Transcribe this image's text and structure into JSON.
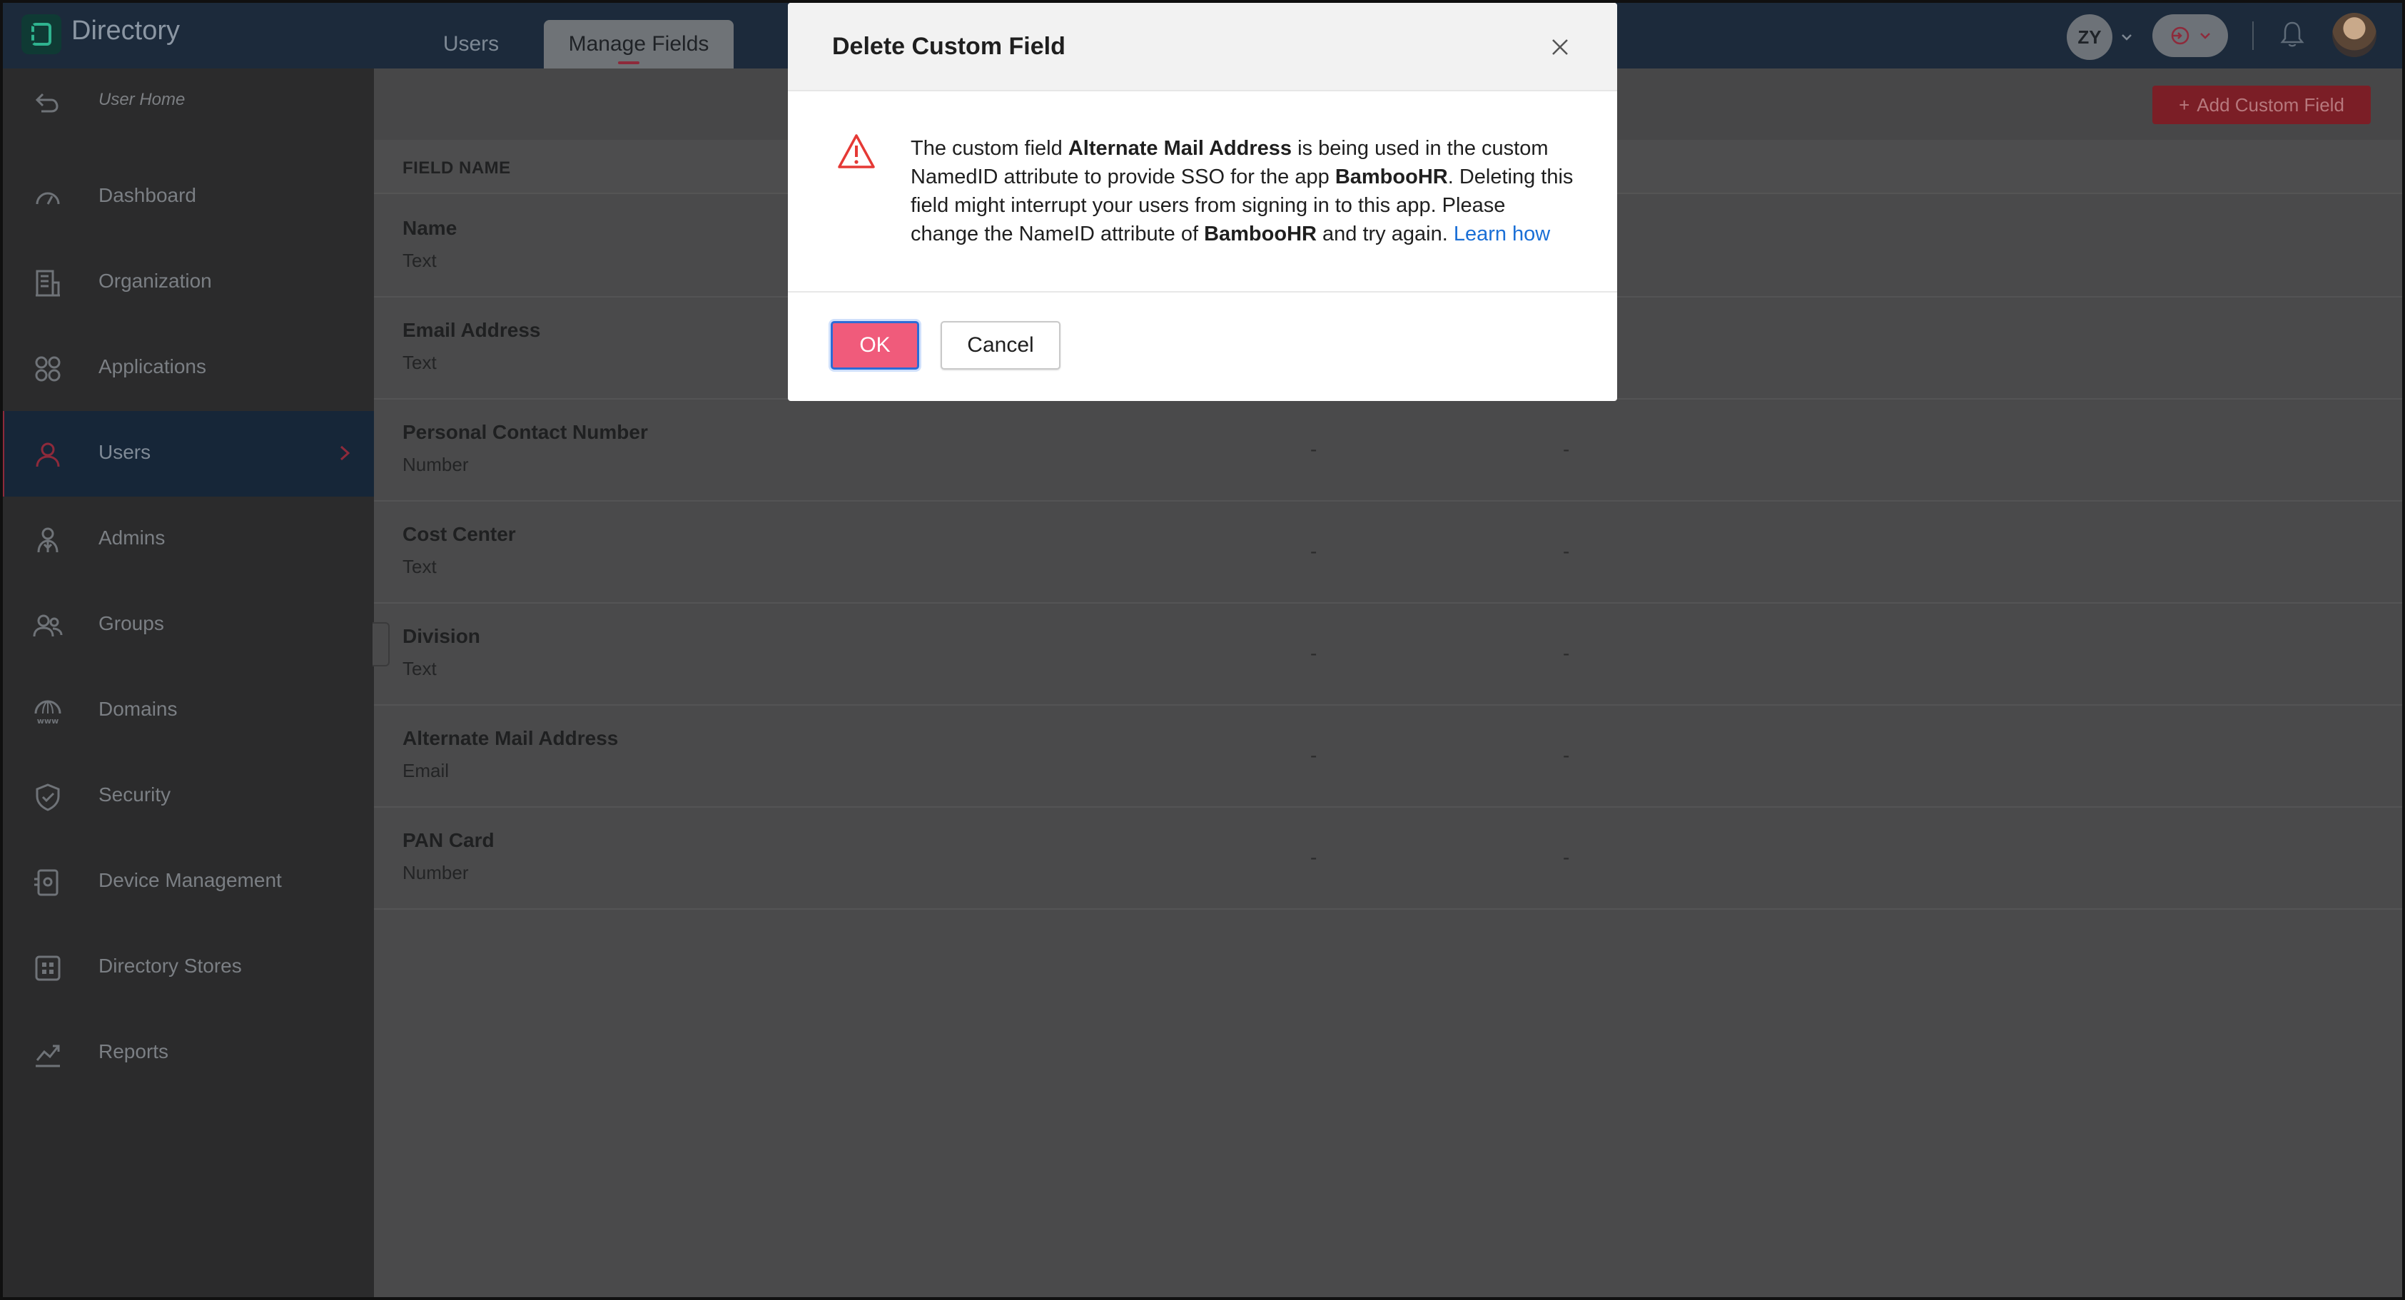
{
  "app": {
    "title": "Directory"
  },
  "top_tabs": [
    {
      "label": "Users"
    },
    {
      "label": "Manage Fields"
    }
  ],
  "header": {
    "avatar_initials": "ZY"
  },
  "sidebar": {
    "back_label": "User Home",
    "items": [
      {
        "label": "Dashboard",
        "icon": "gauge-icon"
      },
      {
        "label": "Organization",
        "icon": "building-icon"
      },
      {
        "label": "Applications",
        "icon": "apps-grid-icon"
      },
      {
        "label": "Users",
        "icon": "user-icon",
        "active": true
      },
      {
        "label": "Admins",
        "icon": "admin-icon"
      },
      {
        "label": "Groups",
        "icon": "group-icon"
      },
      {
        "label": "Domains",
        "icon": "www-icon"
      },
      {
        "label": "Security",
        "icon": "shield-icon"
      },
      {
        "label": "Device Management",
        "icon": "device-icon"
      },
      {
        "label": "Directory Stores",
        "icon": "stores-icon"
      },
      {
        "label": "Reports",
        "icon": "chart-icon"
      }
    ]
  },
  "main": {
    "add_button_label": "Add Custom Field",
    "column_header": "FIELD NAME",
    "rows": [
      {
        "name": "Name",
        "type": "Text",
        "col2": "",
        "col3": ""
      },
      {
        "name": "Email Address",
        "type": "Text",
        "col2": "",
        "col3": ""
      },
      {
        "name": "Personal Contact Number",
        "type": "Number",
        "col2": "-",
        "col3": "-"
      },
      {
        "name": "Cost Center",
        "type": "Text",
        "col2": "-",
        "col3": "-"
      },
      {
        "name": "Division",
        "type": "Text",
        "col2": "-",
        "col3": "-"
      },
      {
        "name": "Alternate Mail Address",
        "type": "Email",
        "col2": "-",
        "col3": "-"
      },
      {
        "name": "PAN Card",
        "type": "Number",
        "col2": "-",
        "col3": "-"
      }
    ]
  },
  "modal": {
    "title": "Delete Custom Field",
    "msg_p1": "The custom field ",
    "field_name": "Alternate Mail Address",
    "msg_p2": " is being used in the custom NamedID attribute to provide SSO for the app ",
    "app_name": "BambooHR",
    "msg_p3": ". Deleting this field might interrupt your users from signing in to this app. Please change the NameID attribute of ",
    "app_name_2": "BambooHR",
    "msg_p4": " and try again. ",
    "learn_link": "Learn how",
    "ok_label": "OK",
    "cancel_label": "Cancel"
  },
  "colors": {
    "accent": "#f05b7b",
    "link": "#1a6fd6",
    "topbar": "#1c2a3b",
    "sidebar_active": "#162638",
    "warning": "#e53935"
  }
}
